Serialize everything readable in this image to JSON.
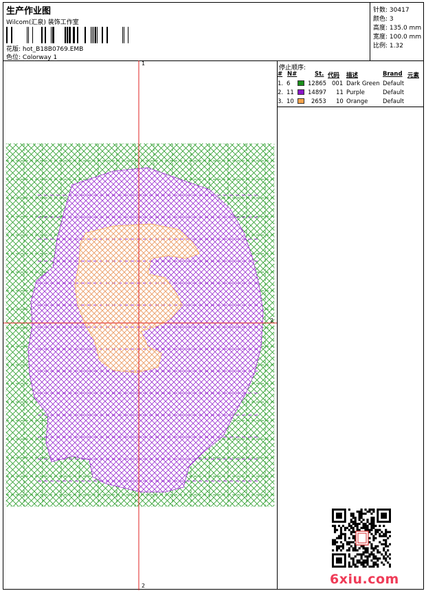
{
  "header": {
    "title": "生产作业图",
    "studio": "Wilcom(汇泉) 装饰工作室",
    "design_file_label": "花版:",
    "design_file": "hot_B18B0769.EMB",
    "colorway_label": "色位:",
    "colorway": "Colorway 1"
  },
  "specs": {
    "stitches_label": "针数:",
    "stitches": "30417",
    "colors_label": "颜色:",
    "colors": "3",
    "height_label": "高度:",
    "height": "135.0 mm",
    "width_label": "宽度:",
    "width": "100.0 mm",
    "scale_label": "比例:",
    "scale": "1.32"
  },
  "stop_sequence": {
    "title": "停止顺序:",
    "headers": [
      "#",
      "N#",
      "St.",
      "代码",
      "描述",
      "Brand",
      "元素"
    ],
    "rows": [
      {
        "index": "1.",
        "needle": "6",
        "color": "#1a8f1a",
        "stitches": "12865",
        "code": "001",
        "desc": "Dark Green",
        "brand": "Default"
      },
      {
        "index": "2.",
        "needle": "11",
        "color": "#8a14c8",
        "stitches": "14897",
        "code": "11",
        "desc": "Purple",
        "brand": "Default"
      },
      {
        "index": "3.",
        "needle": "10",
        "color": "#f5a24a",
        "stitches": "2653",
        "code": "10",
        "desc": "Orange",
        "brand": "Default"
      }
    ]
  },
  "design": {
    "axis_top_label": "1",
    "axis_right_label": "2",
    "axis_bottom_label": "2",
    "axis_color": "#e02020",
    "green": "#2e9e2e",
    "purple": "#9b30d0",
    "orange": "#f7b566"
  },
  "footer": {
    "site_logo": "6xiu.com",
    "logo_color": "#ef3b57"
  }
}
